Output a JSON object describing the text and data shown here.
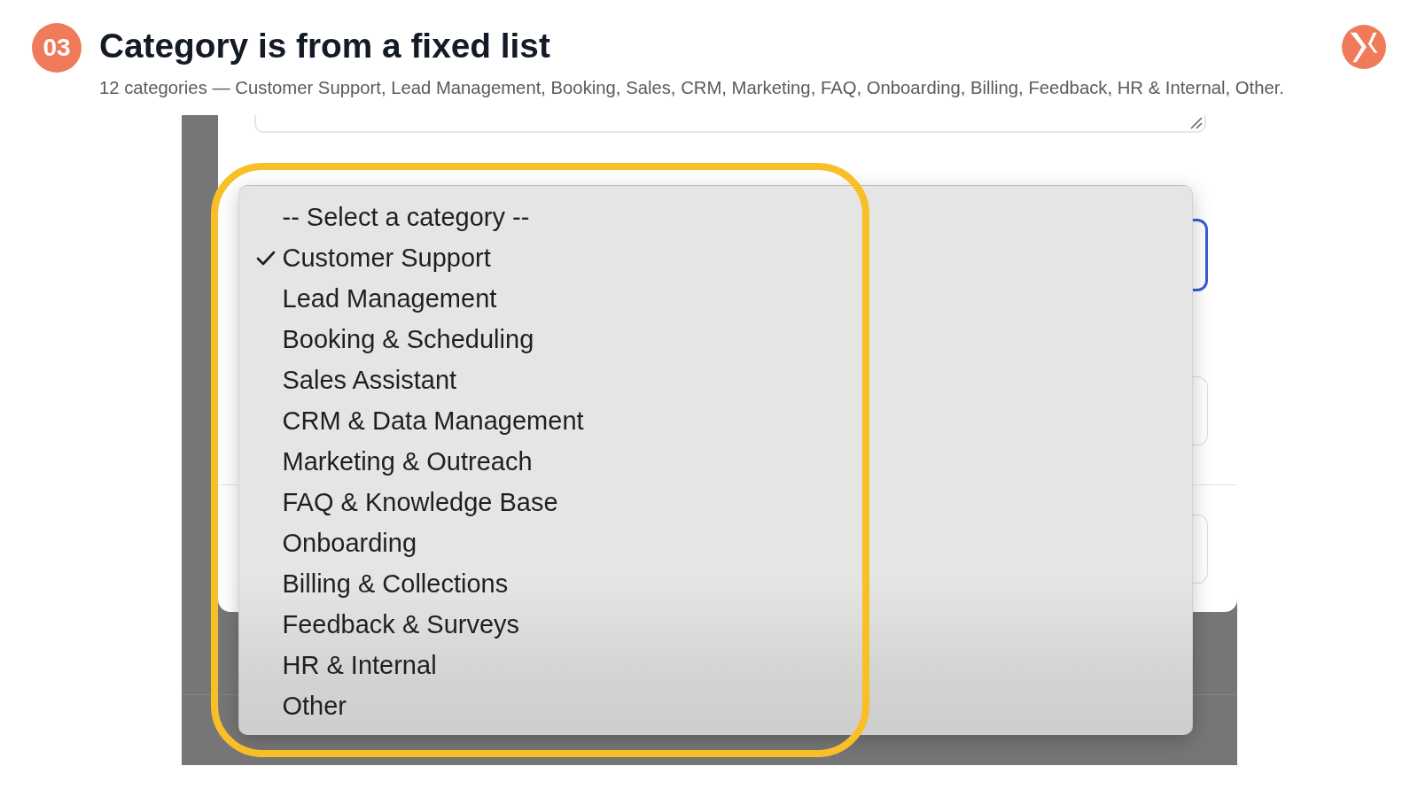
{
  "header": {
    "step": "03",
    "title": "Category is from a fixed list",
    "subtitle": "12 categories — Customer Support, Lead Management, Booking, Sales, CRM, Marketing, FAQ, Onboarding, Billing, Feedback, HR & Internal, Other."
  },
  "screenshot": {
    "form": {
      "category_select": {
        "focused": true
      }
    },
    "category_menu": {
      "options": [
        {
          "label": "-- Select a category --",
          "selected": false
        },
        {
          "label": "Customer Support",
          "selected": true
        },
        {
          "label": "Lead Management",
          "selected": false
        },
        {
          "label": "Booking & Scheduling",
          "selected": false
        },
        {
          "label": "Sales Assistant",
          "selected": false
        },
        {
          "label": "CRM & Data Management",
          "selected": false
        },
        {
          "label": "Marketing & Outreach",
          "selected": false
        },
        {
          "label": "FAQ & Knowledge Base",
          "selected": false
        },
        {
          "label": "Onboarding",
          "selected": false
        },
        {
          "label": "Billing & Collections",
          "selected": false
        },
        {
          "label": "Feedback & Surveys",
          "selected": false
        },
        {
          "label": "HR & Internal",
          "selected": false
        },
        {
          "label": "Other",
          "selected": false
        }
      ]
    }
  }
}
